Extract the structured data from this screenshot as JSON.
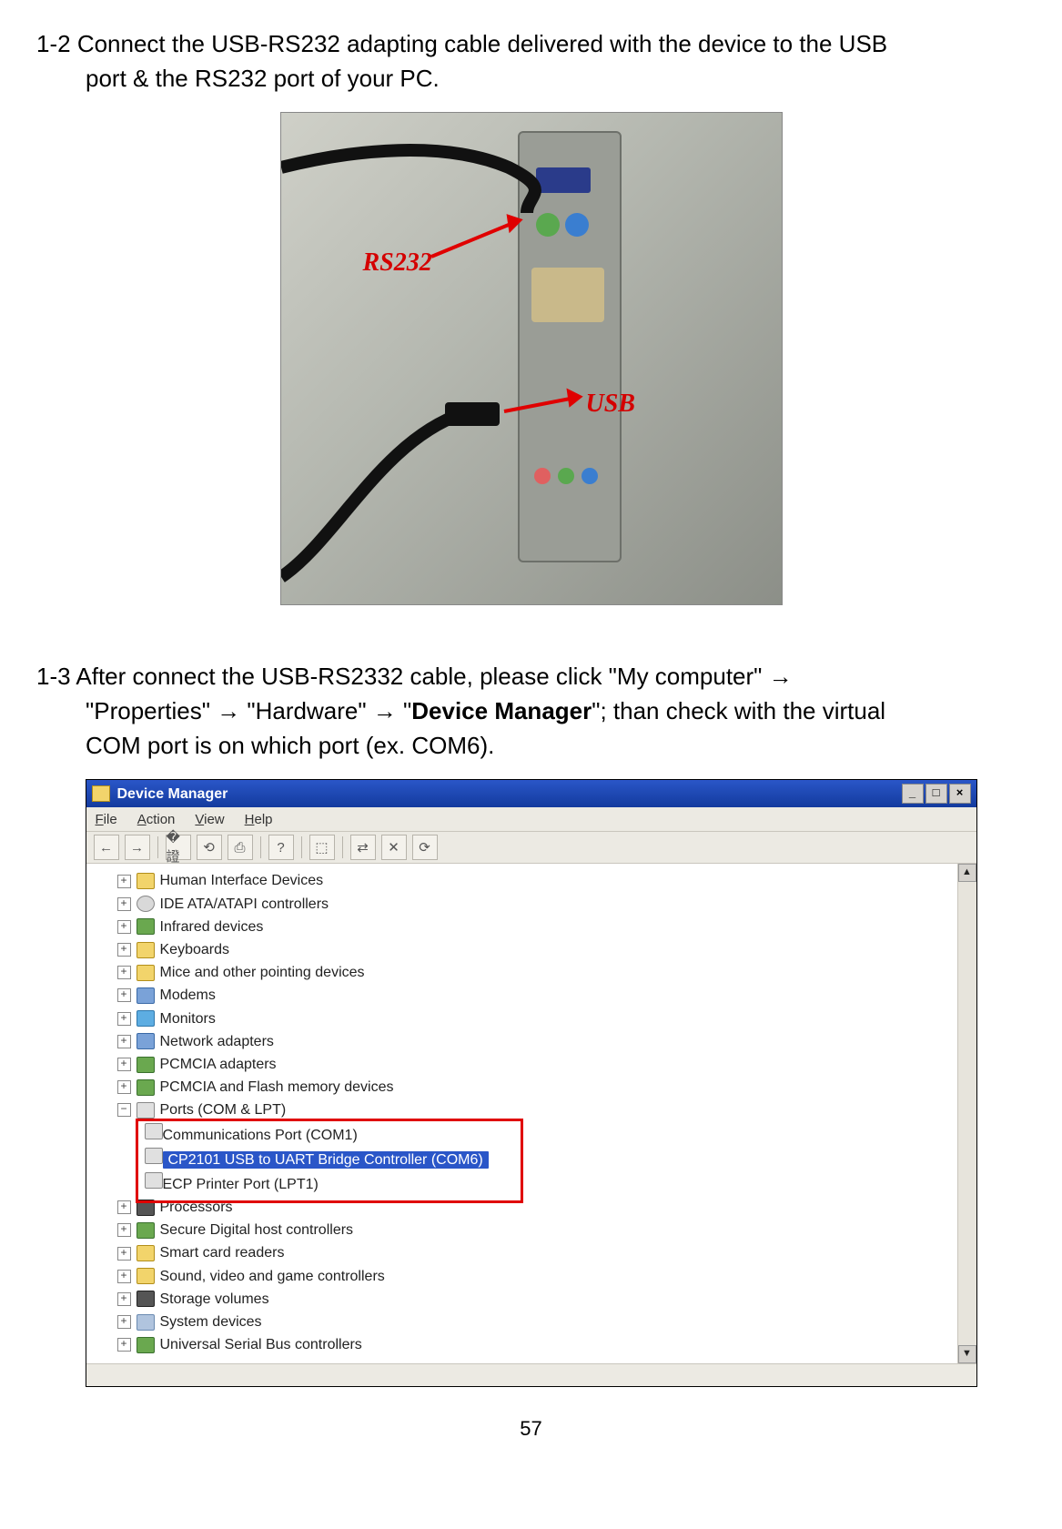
{
  "step12": {
    "num": "1-2",
    "text_a": "Connect the USB-RS232 adapting cable delivered with the device to the USB",
    "text_b": "port & the RS232 port of your PC."
  },
  "photo_labels": {
    "rs232": "RS232",
    "usb": "USB"
  },
  "step13": {
    "num": "1-3",
    "text_a": "After connect the USB-RS2332 cable, please click \"My computer\" →",
    "text_b_1": "\"Properties\" → \"Hardware\" → \"",
    "text_b_bold": "Device Manager",
    "text_b_2": "\"; than check with the virtual",
    "text_c": "COM port is on which port (ex. COM6)."
  },
  "dm": {
    "title": "Device Manager",
    "menu": [
      "File",
      "Action",
      "View",
      "Help"
    ],
    "toolbar_icons": [
      "←",
      "→",
      "�證",
      "⟲",
      "⎙",
      "?",
      "⬚",
      "⇄",
      "✕",
      "⟳"
    ],
    "win_btns": {
      "min": "_",
      "max": "□",
      "close": "×"
    },
    "scroll": {
      "up": "▲",
      "down": "▼"
    },
    "tree": [
      {
        "exp": "+",
        "ico": "folder",
        "label": "Human Interface Devices"
      },
      {
        "exp": "+",
        "ico": "cd",
        "label": "IDE ATA/ATAPI controllers"
      },
      {
        "exp": "+",
        "ico": "chip",
        "label": "Infrared devices"
      },
      {
        "exp": "+",
        "ico": "folder",
        "label": "Keyboards"
      },
      {
        "exp": "+",
        "ico": "folder",
        "label": "Mice and other pointing devices"
      },
      {
        "exp": "+",
        "ico": "net",
        "label": "Modems"
      },
      {
        "exp": "+",
        "ico": "mon",
        "label": "Monitors"
      },
      {
        "exp": "+",
        "ico": "net",
        "label": "Network adapters"
      },
      {
        "exp": "+",
        "ico": "chip",
        "label": "PCMCIA adapters"
      },
      {
        "exp": "+",
        "ico": "chip",
        "label": "PCMCIA and Flash memory devices"
      },
      {
        "exp": "−",
        "ico": "port",
        "label": "Ports (COM & LPT)"
      }
    ],
    "ports_children": [
      {
        "label": "Communications Port (COM1)",
        "sel": false
      },
      {
        "label": "CP2101 USB to UART Bridge Controller (COM6)",
        "sel": true
      },
      {
        "label": "ECP Printer Port (LPT1)",
        "sel": false
      }
    ],
    "tree_after": [
      {
        "exp": "+",
        "ico": "dark",
        "label": "Processors"
      },
      {
        "exp": "+",
        "ico": "chip",
        "label": "Secure Digital host controllers"
      },
      {
        "exp": "+",
        "ico": "folder",
        "label": "Smart card readers"
      },
      {
        "exp": "+",
        "ico": "folder",
        "label": "Sound, video and game controllers"
      },
      {
        "exp": "+",
        "ico": "dark",
        "label": "Storage volumes"
      },
      {
        "exp": "+",
        "ico": "sys",
        "label": "System devices"
      },
      {
        "exp": "+",
        "ico": "chip",
        "label": "Universal Serial Bus controllers"
      }
    ]
  },
  "page_number": "57"
}
